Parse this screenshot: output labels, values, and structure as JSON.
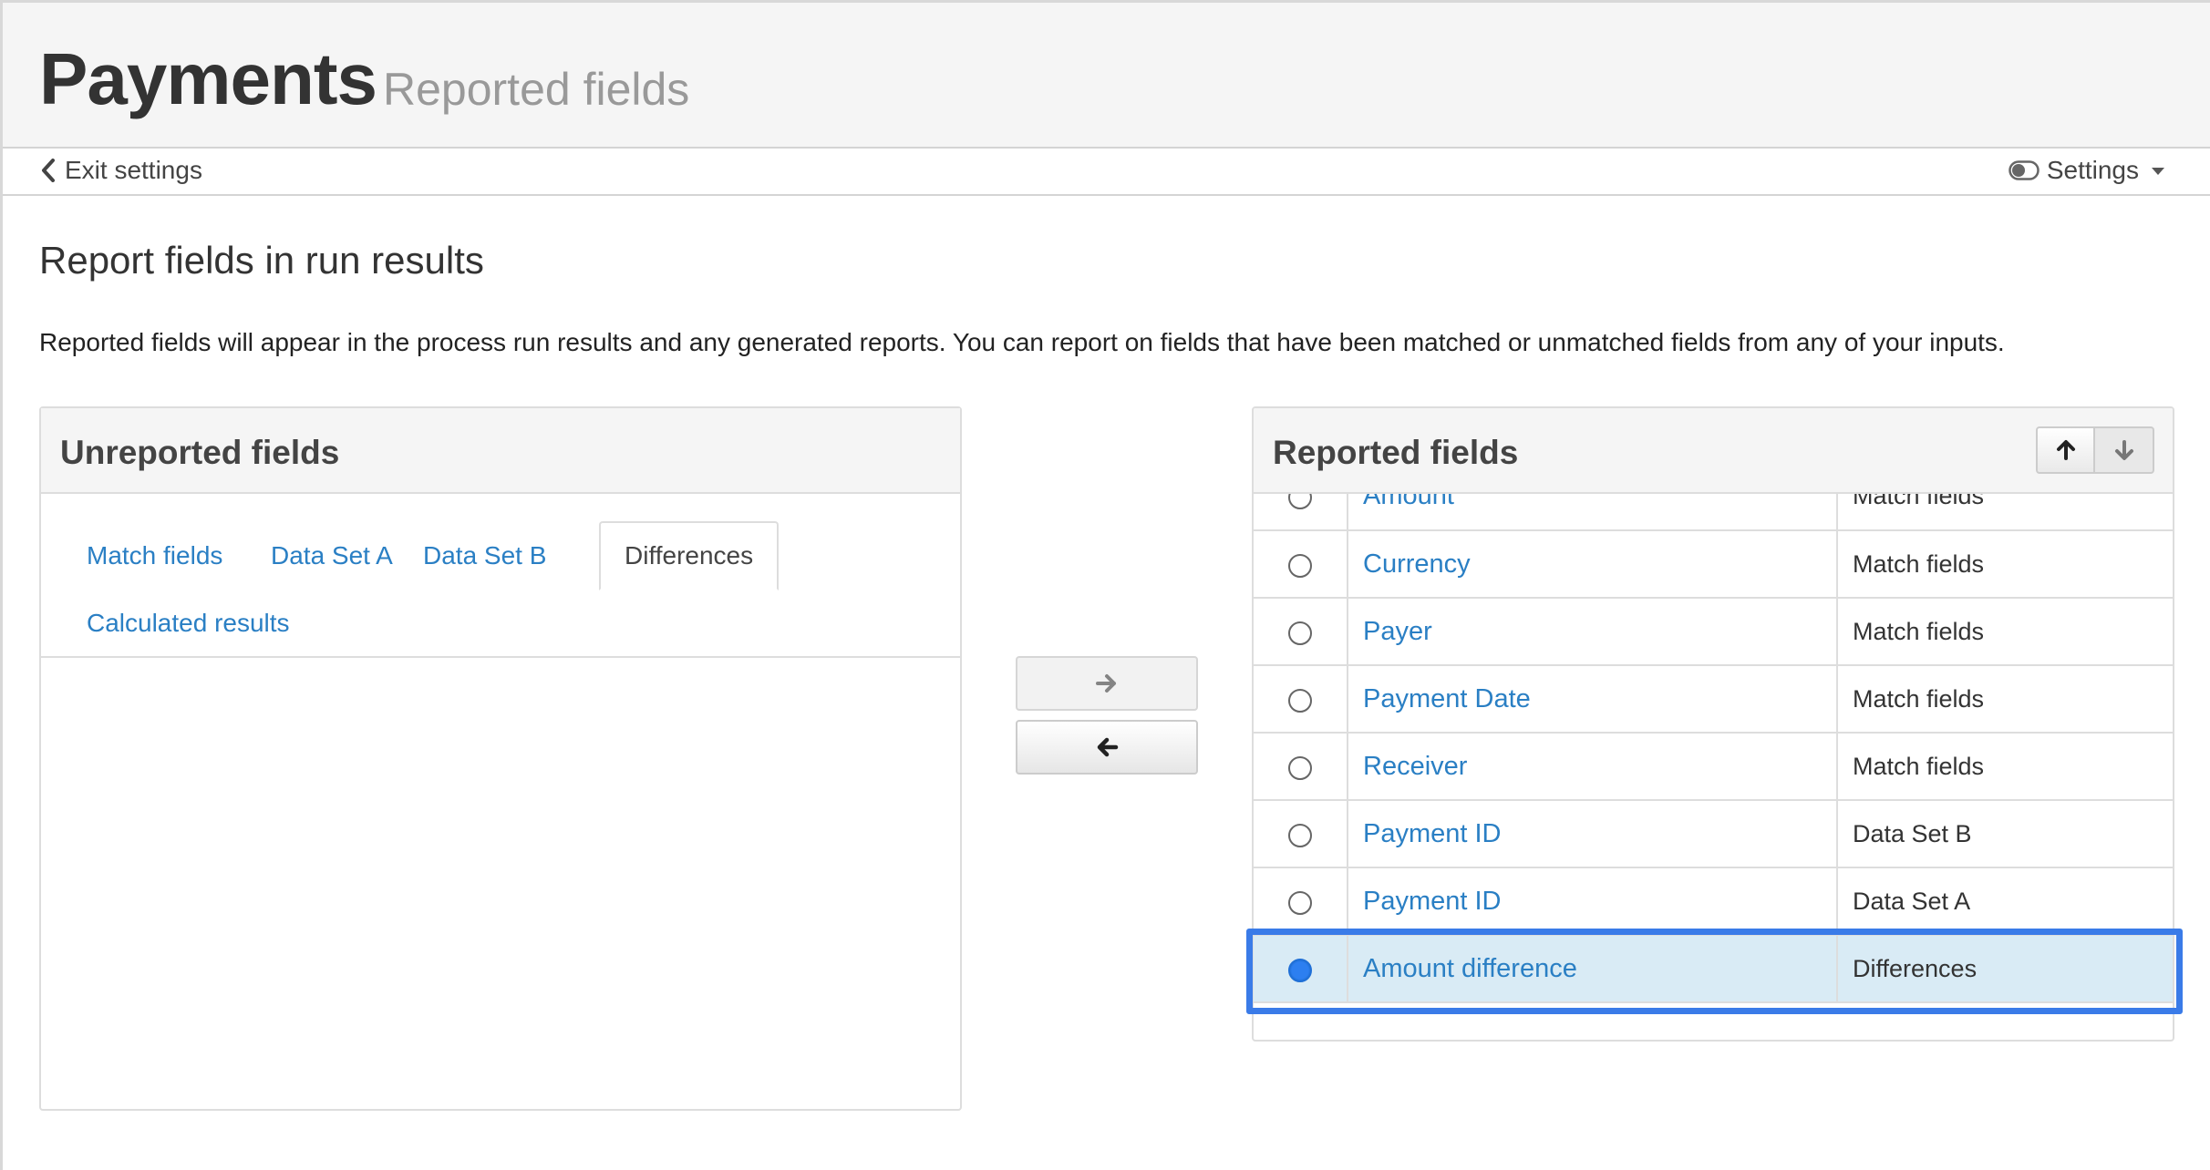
{
  "header": {
    "title": "Payments",
    "subtitle": "Reported fields"
  },
  "toolbar": {
    "exit_label": "Exit settings",
    "settings_label": "Settings"
  },
  "content": {
    "heading": "Report fields in run results",
    "description": "Reported fields will appear in the process run results and any generated reports. You can report on fields that have been matched or unmatched fields from any of your inputs."
  },
  "unreported": {
    "title": "Unreported fields",
    "tabs": [
      {
        "label": "Match fields",
        "active": false
      },
      {
        "label": "Data Set A",
        "active": false
      },
      {
        "label": "Data Set B",
        "active": false
      },
      {
        "label": "Differences",
        "active": true
      },
      {
        "label": "Calculated results",
        "active": false
      }
    ]
  },
  "transfer": {
    "add_icon": "arrow-right-icon",
    "remove_icon": "arrow-left-icon"
  },
  "reported": {
    "title": "Reported fields",
    "move_up_icon": "arrow-up-icon",
    "move_down_icon": "arrow-down-icon",
    "rows": [
      {
        "name": "Amount",
        "source": "Match fields",
        "selected": false
      },
      {
        "name": "Currency",
        "source": "Match fields",
        "selected": false
      },
      {
        "name": "Payer",
        "source": "Match fields",
        "selected": false
      },
      {
        "name": "Payment Date",
        "source": "Match fields",
        "selected": false
      },
      {
        "name": "Receiver",
        "source": "Match fields",
        "selected": false
      },
      {
        "name": "Payment ID",
        "source": "Data Set B",
        "selected": false
      },
      {
        "name": "Payment ID",
        "source": "Data Set A",
        "selected": false
      },
      {
        "name": "Amount difference",
        "source": "Differences",
        "selected": true
      }
    ]
  },
  "colors": {
    "link": "#2a7fc4",
    "selected_row": "#d9ebf5",
    "highlight": "#3a7be8"
  }
}
